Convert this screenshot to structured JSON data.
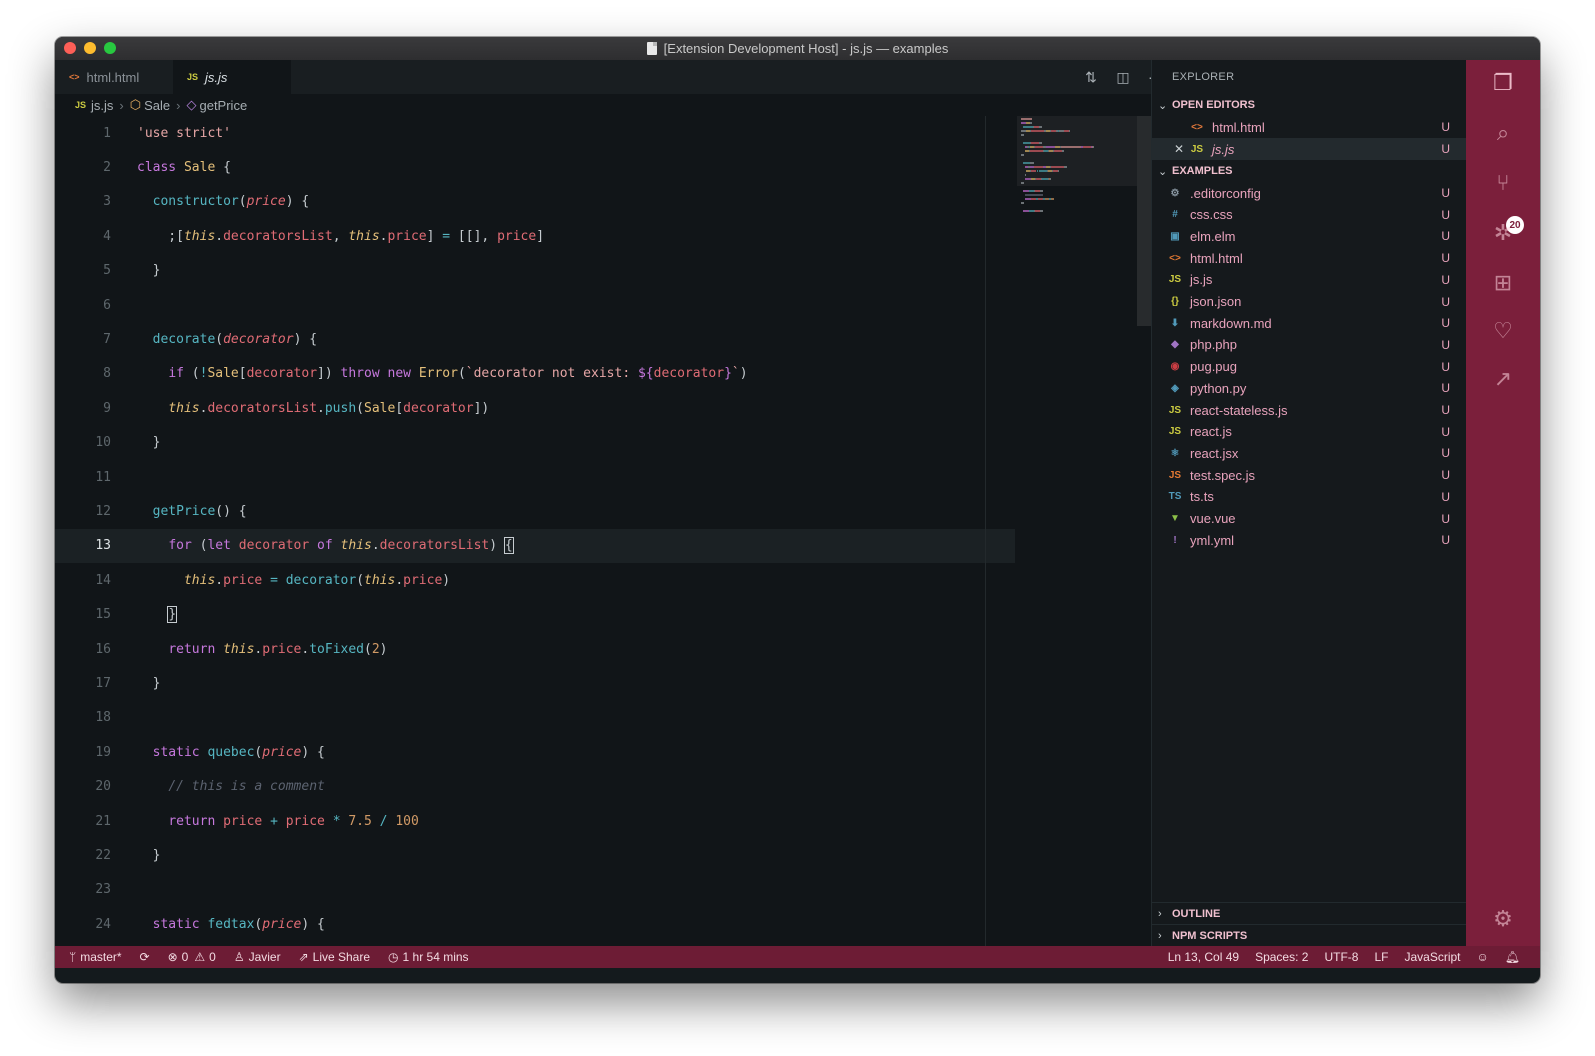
{
  "window": {
    "title": "[Extension Development Host] - js.js — examples"
  },
  "tabs": [
    {
      "label": "html.html",
      "icon": "html-file-icon"
    },
    {
      "label": "js.js",
      "icon": "js-file-icon",
      "active": true
    }
  ],
  "breadcrumb": {
    "file": "js.js",
    "class": "Sale",
    "method": "getPrice"
  },
  "editor": {
    "current_line": 13,
    "lines": [
      [
        {
          "t": "'use strict'",
          "c": "str"
        }
      ],
      [
        {
          "t": "class ",
          "c": "kw"
        },
        {
          "t": "Sale",
          "c": "cls"
        },
        {
          "t": " {",
          "c": "plain"
        }
      ],
      [
        {
          "t": "  ",
          "c": "plain"
        },
        {
          "t": "constructor",
          "c": "fn"
        },
        {
          "t": "(",
          "c": "plain"
        },
        {
          "t": "price",
          "c": "param"
        },
        {
          "t": ") {",
          "c": "plain"
        }
      ],
      [
        {
          "t": "    ;[",
          "c": "plain"
        },
        {
          "t": "this",
          "c": "this"
        },
        {
          "t": ".",
          "c": "plain"
        },
        {
          "t": "decoratorsList",
          "c": "prop"
        },
        {
          "t": ", ",
          "c": "plain"
        },
        {
          "t": "this",
          "c": "this"
        },
        {
          "t": ".",
          "c": "plain"
        },
        {
          "t": "price",
          "c": "prop"
        },
        {
          "t": "] ",
          "c": "plain"
        },
        {
          "t": "=",
          "c": "op"
        },
        {
          "t": " [[], ",
          "c": "plain"
        },
        {
          "t": "price",
          "c": "prop"
        },
        {
          "t": "]",
          "c": "plain"
        }
      ],
      [
        {
          "t": "  }",
          "c": "plain"
        }
      ],
      [],
      [
        {
          "t": "  ",
          "c": "plain"
        },
        {
          "t": "decorate",
          "c": "fn"
        },
        {
          "t": "(",
          "c": "plain"
        },
        {
          "t": "decorator",
          "c": "param"
        },
        {
          "t": ") {",
          "c": "plain"
        }
      ],
      [
        {
          "t": "    ",
          "c": "plain"
        },
        {
          "t": "if",
          "c": "kw"
        },
        {
          "t": " (",
          "c": "plain"
        },
        {
          "t": "!",
          "c": "op"
        },
        {
          "t": "Sale",
          "c": "cls"
        },
        {
          "t": "[",
          "c": "plain"
        },
        {
          "t": "decorator",
          "c": "prop"
        },
        {
          "t": "]) ",
          "c": "plain"
        },
        {
          "t": "throw new ",
          "c": "kw"
        },
        {
          "t": "Error",
          "c": "cls"
        },
        {
          "t": "(",
          "c": "plain"
        },
        {
          "t": "`decorator not exist: ",
          "c": "str"
        },
        {
          "t": "${",
          "c": "tpl"
        },
        {
          "t": "decorator",
          "c": "prop"
        },
        {
          "t": "}",
          "c": "tpl"
        },
        {
          "t": "`",
          "c": "str"
        },
        {
          "t": ")",
          "c": "plain"
        }
      ],
      [
        {
          "t": "    ",
          "c": "plain"
        },
        {
          "t": "this",
          "c": "this"
        },
        {
          "t": ".",
          "c": "plain"
        },
        {
          "t": "decoratorsList",
          "c": "prop"
        },
        {
          "t": ".",
          "c": "plain"
        },
        {
          "t": "push",
          "c": "fn"
        },
        {
          "t": "(",
          "c": "plain"
        },
        {
          "t": "Sale",
          "c": "cls"
        },
        {
          "t": "[",
          "c": "plain"
        },
        {
          "t": "decorator",
          "c": "prop"
        },
        {
          "t": "])",
          "c": "plain"
        }
      ],
      [
        {
          "t": "  }",
          "c": "plain"
        }
      ],
      [],
      [
        {
          "t": "  ",
          "c": "plain"
        },
        {
          "t": "getPrice",
          "c": "fn"
        },
        {
          "t": "() {",
          "c": "plain"
        }
      ],
      [
        {
          "t": "    ",
          "c": "plain"
        },
        {
          "t": "for",
          "c": "kw"
        },
        {
          "t": " (",
          "c": "plain"
        },
        {
          "t": "let ",
          "c": "kw"
        },
        {
          "t": "decorator ",
          "c": "prop"
        },
        {
          "t": "of ",
          "c": "kw"
        },
        {
          "t": "this",
          "c": "this"
        },
        {
          "t": ".",
          "c": "plain"
        },
        {
          "t": "decoratorsList",
          "c": "prop"
        },
        {
          "t": ") ",
          "c": "plain"
        },
        {
          "t": "{",
          "c": "bracket"
        }
      ],
      [
        {
          "t": "      ",
          "c": "plain"
        },
        {
          "t": "this",
          "c": "this"
        },
        {
          "t": ".",
          "c": "plain"
        },
        {
          "t": "price",
          "c": "prop"
        },
        {
          "t": " ",
          "c": "plain"
        },
        {
          "t": "=",
          "c": "op"
        },
        {
          "t": " ",
          "c": "plain"
        },
        {
          "t": "decorator",
          "c": "fn"
        },
        {
          "t": "(",
          "c": "plain"
        },
        {
          "t": "this",
          "c": "this"
        },
        {
          "t": ".",
          "c": "plain"
        },
        {
          "t": "price",
          "c": "prop"
        },
        {
          "t": ")",
          "c": "plain"
        }
      ],
      [
        {
          "t": "    ",
          "c": "plain"
        },
        {
          "t": "}",
          "c": "bracket"
        }
      ],
      [
        {
          "t": "    ",
          "c": "plain"
        },
        {
          "t": "return ",
          "c": "kw"
        },
        {
          "t": "this",
          "c": "this"
        },
        {
          "t": ".",
          "c": "plain"
        },
        {
          "t": "price",
          "c": "prop"
        },
        {
          "t": ".",
          "c": "plain"
        },
        {
          "t": "toFixed",
          "c": "fn"
        },
        {
          "t": "(",
          "c": "plain"
        },
        {
          "t": "2",
          "c": "num"
        },
        {
          "t": ")",
          "c": "plain"
        }
      ],
      [
        {
          "t": "  }",
          "c": "plain"
        }
      ],
      [],
      [
        {
          "t": "  ",
          "c": "plain"
        },
        {
          "t": "static ",
          "c": "kw"
        },
        {
          "t": "quebec",
          "c": "fn"
        },
        {
          "t": "(",
          "c": "plain"
        },
        {
          "t": "price",
          "c": "param"
        },
        {
          "t": ") {",
          "c": "plain"
        }
      ],
      [
        {
          "t": "    ",
          "c": "plain"
        },
        {
          "t": "// this is a comment",
          "c": "com"
        }
      ],
      [
        {
          "t": "    ",
          "c": "plain"
        },
        {
          "t": "return ",
          "c": "kw"
        },
        {
          "t": "price ",
          "c": "prop"
        },
        {
          "t": "+ ",
          "c": "op"
        },
        {
          "t": "price ",
          "c": "prop"
        },
        {
          "t": "* ",
          "c": "op"
        },
        {
          "t": "7.5 ",
          "c": "num"
        },
        {
          "t": "/ ",
          "c": "op"
        },
        {
          "t": "100",
          "c": "num"
        }
      ],
      [
        {
          "t": "  }",
          "c": "plain"
        }
      ],
      [],
      [
        {
          "t": "  ",
          "c": "plain"
        },
        {
          "t": "static ",
          "c": "kw"
        },
        {
          "t": "fedtax",
          "c": "fn"
        },
        {
          "t": "(",
          "c": "plain"
        },
        {
          "t": "price",
          "c": "param"
        },
        {
          "t": ") {",
          "c": "plain"
        }
      ]
    ]
  },
  "explorer": {
    "title": "EXPLORER",
    "open_editors_label": "OPEN EDITORS",
    "open_editors": [
      {
        "name": "html.html",
        "icon": "html-file-icon",
        "status": "U"
      },
      {
        "name": "js.js",
        "icon": "js-file-icon",
        "status": "U",
        "active": true
      }
    ],
    "folder_label": "EXAMPLES",
    "files": [
      {
        "name": ".editorconfig",
        "icon": "gear-file-icon",
        "glyph": "⚙",
        "color": "#8a98a3",
        "status": "U"
      },
      {
        "name": "css.css",
        "icon": "css-file-icon",
        "glyph": "#",
        "color": "#519aba",
        "status": "U"
      },
      {
        "name": "elm.elm",
        "icon": "elm-file-icon",
        "glyph": "▣",
        "color": "#519aba",
        "status": "U"
      },
      {
        "name": "html.html",
        "icon": "html-file-icon",
        "glyph": "<>",
        "color": "#e37933",
        "status": "U"
      },
      {
        "name": "js.js",
        "icon": "js-file-icon",
        "glyph": "JS",
        "color": "#cbcb41",
        "status": "U"
      },
      {
        "name": "json.json",
        "icon": "json-file-icon",
        "glyph": "{}",
        "color": "#cbcb41",
        "status": "U"
      },
      {
        "name": "markdown.md",
        "icon": "markdown-file-icon",
        "glyph": "⬇",
        "color": "#519aba",
        "status": "U"
      },
      {
        "name": "php.php",
        "icon": "php-file-icon",
        "glyph": "◆",
        "color": "#a074c4",
        "status": "U"
      },
      {
        "name": "pug.pug",
        "icon": "pug-file-icon",
        "glyph": "◉",
        "color": "#cc3e44",
        "status": "U"
      },
      {
        "name": "python.py",
        "icon": "python-file-icon",
        "glyph": "◈",
        "color": "#519aba",
        "status": "U"
      },
      {
        "name": "react-stateless.js",
        "icon": "js-file-icon",
        "glyph": "JS",
        "color": "#cbcb41",
        "status": "U"
      },
      {
        "name": "react.js",
        "icon": "js-file-icon",
        "glyph": "JS",
        "color": "#cbcb41",
        "status": "U"
      },
      {
        "name": "react.jsx",
        "icon": "react-file-icon",
        "glyph": "⚛",
        "color": "#519aba",
        "status": "U"
      },
      {
        "name": "test.spec.js",
        "icon": "test-js-file-icon",
        "glyph": "JS",
        "color": "#e37933",
        "status": "U"
      },
      {
        "name": "ts.ts",
        "icon": "ts-file-icon",
        "glyph": "TS",
        "color": "#519aba",
        "status": "U"
      },
      {
        "name": "vue.vue",
        "icon": "vue-file-icon",
        "glyph": "▼",
        "color": "#8dc149",
        "status": "U"
      },
      {
        "name": "yml.yml",
        "icon": "yml-file-icon",
        "glyph": "!",
        "color": "#a074c4",
        "status": "U"
      }
    ],
    "outline_label": "OUTLINE",
    "npm_label": "NPM SCRIPTS"
  },
  "activity": {
    "scm_badge": "20"
  },
  "status": {
    "branch": "master*",
    "errors": "0",
    "warnings": "0",
    "user": "Javier",
    "live_share": "Live Share",
    "time": "1 hr 54 mins",
    "position": "Ln 13, Col 49",
    "spaces": "Spaces: 2",
    "encoding": "UTF-8",
    "eol": "LF",
    "language": "JavaScript"
  },
  "colors": {
    "accent": "#7b1f3b",
    "statusbar": "#6d1c35",
    "editor_bg": "#111518"
  }
}
